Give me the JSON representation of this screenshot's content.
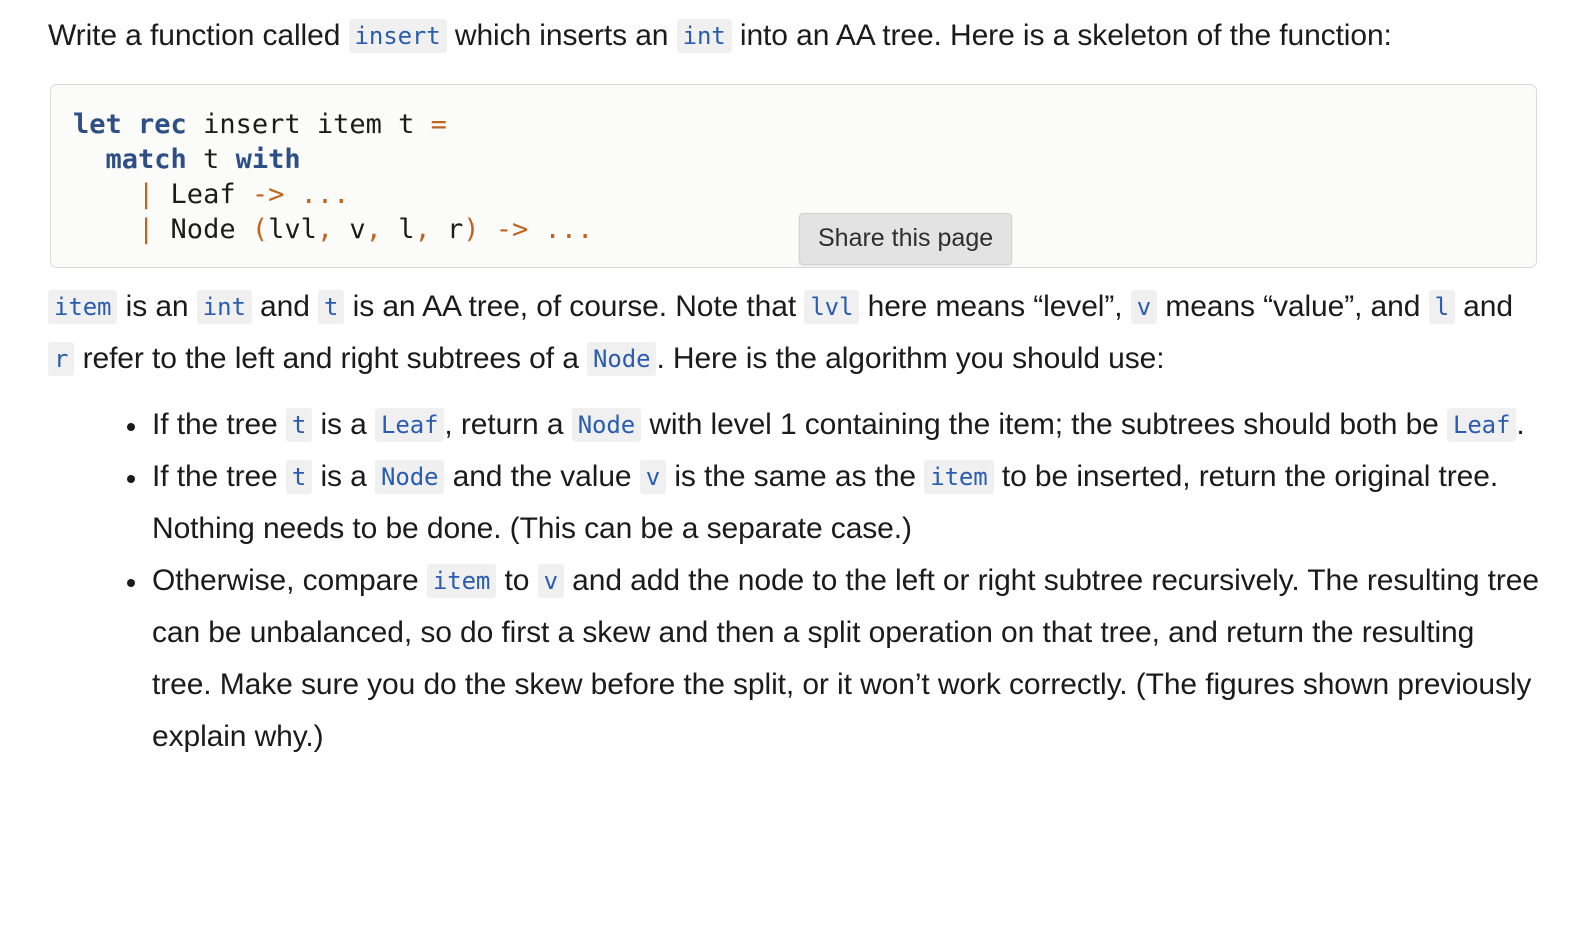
{
  "intro": {
    "seg1": "Write a function called ",
    "code1": "insert",
    "seg2": " which inserts an ",
    "code2": "int",
    "seg3": " into an AA tree. Here is a skeleton of the function:"
  },
  "codeblock": {
    "language": "ocaml",
    "lines": [
      [
        {
          "t": "let",
          "c": "kw"
        },
        {
          "t": " ",
          "c": "id"
        },
        {
          "t": "rec",
          "c": "kw"
        },
        {
          "t": " insert item t ",
          "c": "id"
        },
        {
          "t": "=",
          "c": "op"
        }
      ],
      [
        {
          "t": "  ",
          "c": "id"
        },
        {
          "t": "match",
          "c": "kw"
        },
        {
          "t": " t ",
          "c": "id"
        },
        {
          "t": "with",
          "c": "kw"
        }
      ],
      [
        {
          "t": "    ",
          "c": "id"
        },
        {
          "t": "|",
          "c": "op"
        },
        {
          "t": " Leaf ",
          "c": "id"
        },
        {
          "t": "->",
          "c": "op"
        },
        {
          "t": " ",
          "c": "id"
        },
        {
          "t": "...",
          "c": "op"
        }
      ],
      [
        {
          "t": "    ",
          "c": "id"
        },
        {
          "t": "|",
          "c": "op"
        },
        {
          "t": " Node ",
          "c": "id"
        },
        {
          "t": "(",
          "c": "op"
        },
        {
          "t": "lvl",
          "c": "id"
        },
        {
          "t": ",",
          "c": "op"
        },
        {
          "t": " v",
          "c": "id"
        },
        {
          "t": ",",
          "c": "op"
        },
        {
          "t": " l",
          "c": "id"
        },
        {
          "t": ",",
          "c": "op"
        },
        {
          "t": " r",
          "c": "id"
        },
        {
          "t": ")",
          "c": "op"
        },
        {
          "t": " ",
          "c": "id"
        },
        {
          "t": "->",
          "c": "op"
        },
        {
          "t": " ",
          "c": "id"
        },
        {
          "t": "...",
          "c": "op"
        }
      ]
    ],
    "plain_text": "let rec insert item t =\n  match t with\n    | Leaf -> ...\n    | Node (lvl, v, l, r) -> ..."
  },
  "share_tooltip": {
    "label": "Share this page"
  },
  "explanation": {
    "code_item": "item",
    "seg1": " is an ",
    "code_int": "int",
    "seg2": " and ",
    "code_t": "t",
    "seg3": " is an AA tree, of course. Note that ",
    "code_lvl": "lvl",
    "seg4": " here means “level”, ",
    "code_v": "v",
    "seg5": " means “value”, and ",
    "code_l": "l",
    "seg6": " and ",
    "code_r": "r",
    "seg7": " refer to the left and right subtrees of a ",
    "code_node": "Node",
    "seg8": ". Here is the algorithm you should use:"
  },
  "steps": [
    {
      "seg1": "If the tree ",
      "code1": "t",
      "seg2": " is a ",
      "code2": "Leaf",
      "seg3": ", return a ",
      "code3": "Node",
      "seg4": " with level 1 containing the item; the subtrees should both be ",
      "code4": "Leaf",
      "seg5": "."
    },
    {
      "seg1": "If the tree ",
      "code1": "t",
      "seg2": " is a ",
      "code2": "Node",
      "seg3": " and the value ",
      "code3": "v",
      "seg4": " is the same as the ",
      "code4": "item",
      "seg5": " to be inserted, return the original tree. Nothing needs to be done. (This can be a separate case.)"
    },
    {
      "seg1": "Otherwise, compare ",
      "code1": "item",
      "seg2": " to ",
      "code2": "v",
      "seg3": " and add the node to the left or right subtree recursively. The resulting tree can be unbalanced, so do first a skew and then a split operation on that tree, and return the resulting tree. Make sure you do the skew before the split, or it won’t work correctly. (The figures shown previously explain why.)"
    }
  ],
  "colors": {
    "text": "#1b1b1b",
    "inline_code_text": "#2a5db0",
    "inline_code_bg": "#f0f0f0",
    "keyword": "#2d4f85",
    "operator": "#c1651c",
    "codeblock_bg": "#fbfbfa",
    "codeblock_border": "#d9d9d9",
    "tooltip_bg": "#e3e3e3"
  }
}
